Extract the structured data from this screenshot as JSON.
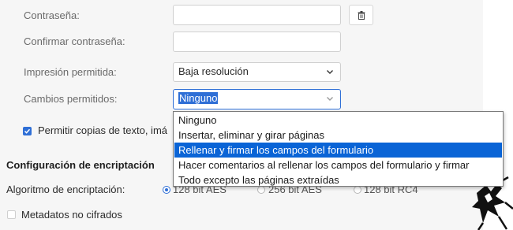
{
  "form": {
    "password_label": "Contraseña:",
    "password_value": "",
    "confirm_label": "Confirmar contraseña:",
    "confirm_value": "",
    "print_label": "Impresión permitida:",
    "print_value": "Baja resolución",
    "changes_label": "Cambios permitidos:",
    "changes_value": "Ninguno",
    "copy_text_checkbox_label": "Permitir copias de texto, imá",
    "copy_text_checked": true
  },
  "encryption": {
    "section_title": "Configuración de encriptación",
    "algorithm_label": "Algoritmo de encriptación:",
    "options": [
      "128 bit AES",
      "256 bit AES",
      "128 bit RC4"
    ],
    "selected": "128 bit AES",
    "metadata_label": "Metadatos no cifrados",
    "metadata_checked": false
  },
  "dropdown": {
    "options": [
      "Ninguno",
      "Insertar, eliminar y girar páginas",
      "Rellenar y firmar los campos del formulario",
      "Hacer comentarios al rellenar los campos del formulario y firmar",
      "Todo excepto las páginas extraídas"
    ],
    "highlighted": "Rellenar y firmar los campos del formulario"
  },
  "icons": {
    "trash": "trash-icon",
    "chevron": "chevron-down-icon",
    "check": "check-icon"
  },
  "colors": {
    "accent": "#2f6fd6",
    "highlight": "#0a64d6",
    "panel_bg": "#f6f6f6"
  }
}
